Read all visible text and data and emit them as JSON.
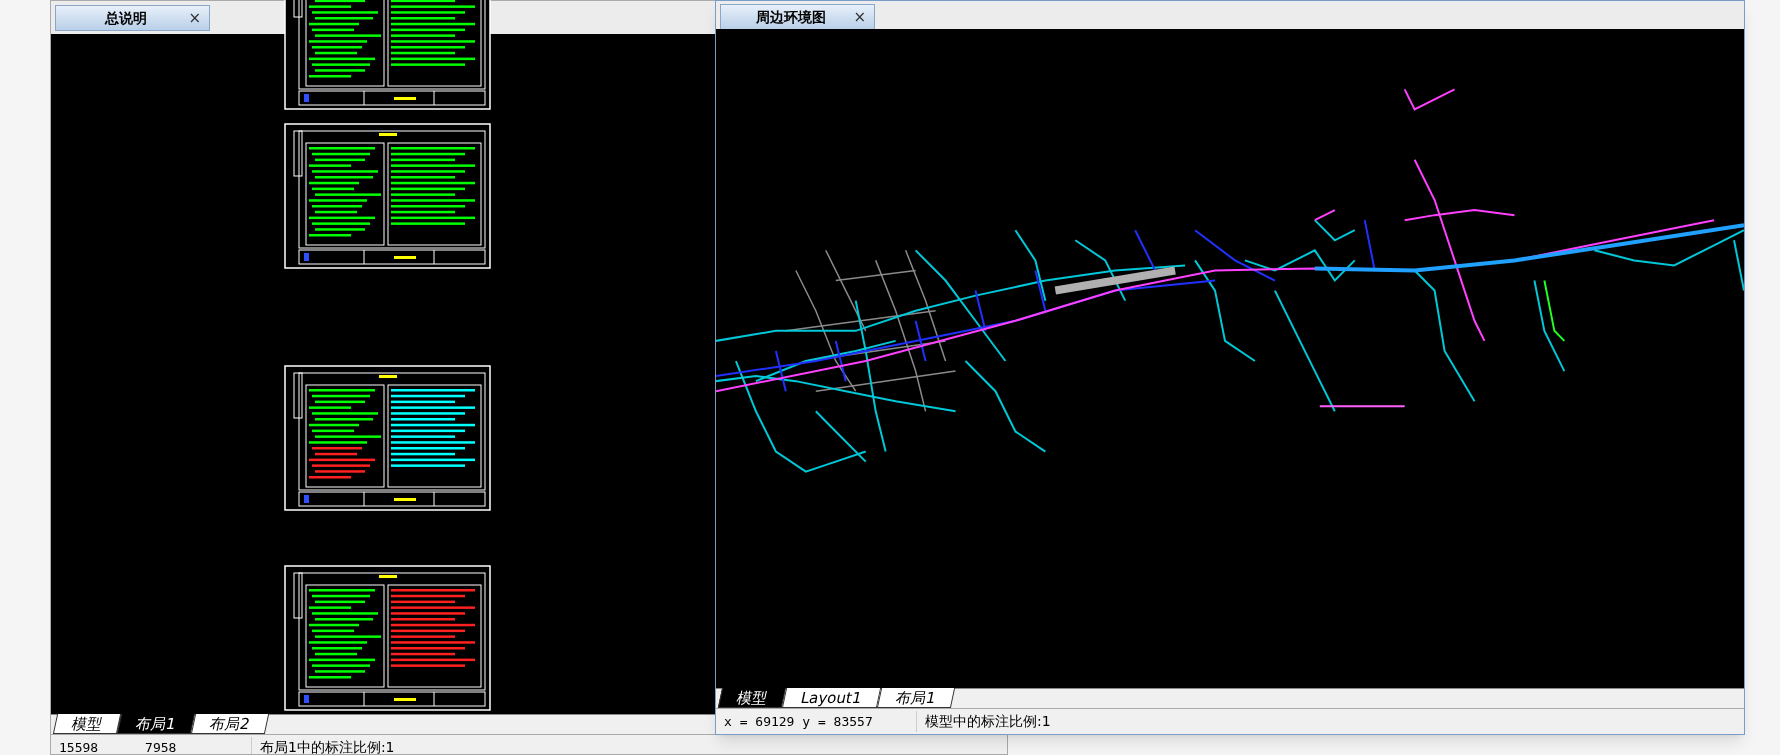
{
  "windows": [
    {
      "tab": {
        "title": "总说明",
        "close": "×"
      },
      "layout_tabs": [
        {
          "label": "模型",
          "selected": false
        },
        {
          "label": "布局1",
          "selected": true
        },
        {
          "label": "布局2",
          "selected": false
        }
      ],
      "status": {
        "coords": "15598      7958",
        "scale": "布局1中的标注比例:1"
      }
    },
    {
      "tab": {
        "title": "周边环境图",
        "close": "×"
      },
      "layout_tabs": [
        {
          "label": "模型",
          "selected": true
        },
        {
          "label": "Layout1",
          "selected": false
        },
        {
          "label": "布局1",
          "selected": false
        }
      ],
      "status": {
        "coords": "x = 69129 y = 83557",
        "scale": "模型中的标注比例:1"
      }
    }
  ]
}
